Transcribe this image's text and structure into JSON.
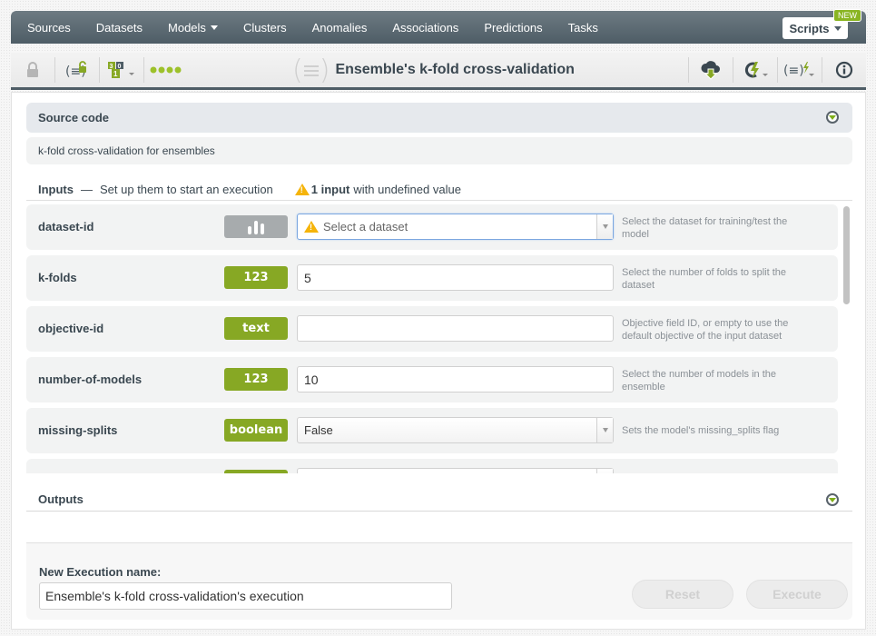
{
  "nav": {
    "items": [
      {
        "label": "Sources",
        "dropdown": false
      },
      {
        "label": "Datasets",
        "dropdown": false
      },
      {
        "label": "Models",
        "dropdown": true
      },
      {
        "label": "Clusters",
        "dropdown": false
      },
      {
        "label": "Anomalies",
        "dropdown": false
      },
      {
        "label": "Associations",
        "dropdown": false
      },
      {
        "label": "Predictions",
        "dropdown": false
      },
      {
        "label": "Tasks",
        "dropdown": false
      }
    ],
    "scripts_label": "Scripts",
    "new_badge": "NEW"
  },
  "toolbar": {
    "title": "Ensemble's k-fold cross-validation",
    "icons": [
      "lock-icon",
      "script-unlock-icon",
      "counter-icon",
      "status-dots-icon",
      "cloud-download-icon",
      "execute-icon",
      "script-execute-icon",
      "info-icon"
    ]
  },
  "source_code": {
    "header": "Source code",
    "description": "k-fold cross-validation for ensembles"
  },
  "inputs": {
    "title": "Inputs",
    "dash": "—",
    "subtitle": "Set up them to start an execution",
    "warning_bold": "1 input",
    "warning_rest": "with undefined value",
    "params": [
      {
        "name": "dataset-id",
        "type": "dataset",
        "value": "",
        "placeholder": "Select a dataset",
        "help": "Select the dataset for training/test the model"
      },
      {
        "name": "k-folds",
        "type": "123",
        "value": "5",
        "placeholder": "",
        "help": "Select the number of folds to split the dataset"
      },
      {
        "name": "objective-id",
        "type": "text",
        "value": "",
        "placeholder": "",
        "help": "Objective field ID, or empty to use the default objective of the input dataset"
      },
      {
        "name": "number-of-models",
        "type": "123",
        "value": "10",
        "placeholder": "",
        "help": "Select the number of models in the ensemble"
      },
      {
        "name": "missing-splits",
        "type": "boolean",
        "value": "False",
        "placeholder": "",
        "help": "Sets the model's missing_splits flag"
      }
    ]
  },
  "outputs": {
    "header": "Outputs"
  },
  "execution": {
    "label": "New Execution name:",
    "value": "Ensemble's k-fold cross-validation's execution",
    "reset_label": "Reset",
    "execute_label": "Execute"
  },
  "colors": {
    "nav_bg": "#55646d",
    "accent_green": "#87a824",
    "warning": "#f5b40a"
  }
}
